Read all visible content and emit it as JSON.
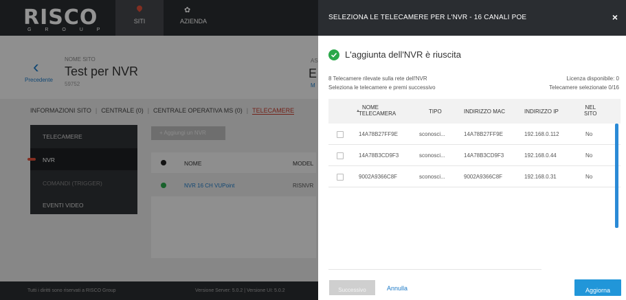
{
  "app": {
    "logo": "RISCO",
    "logo_sub": "G R O U P",
    "nav": {
      "siti": "SITI",
      "azienda": "AZIENDA"
    }
  },
  "site": {
    "back_label": "Precedente",
    "name_label": "NOME SITO",
    "name": "Test per NVR",
    "id": "59752",
    "partial_label": "AS",
    "partial_value": "E",
    "partial_link": "M"
  },
  "tabs": [
    {
      "label": "INFORMAZIONI SITO"
    },
    {
      "label": "CENTRALE (0)"
    },
    {
      "label": "CENTRALE OPERATIVA MS (0)"
    },
    {
      "label": "TELECAMERE"
    }
  ],
  "sidemenu": [
    {
      "label": "TELECAMERE"
    },
    {
      "label": "NVR"
    },
    {
      "label": "COMANDI (TRIGGER)"
    },
    {
      "label": "EVENTI VIDEO"
    }
  ],
  "nvr_list": {
    "add_button": "+ Aggiungi un NVR",
    "columns": {
      "name": "NOME",
      "model": "MODEL"
    },
    "rows": [
      {
        "name": "NVR 16 CH VUPoint",
        "model": "RISNVR"
      }
    ]
  },
  "footer": {
    "rights": "Tutti i diritti sono riservati a RISCO Group",
    "version": "Versione Server: 5.0.2  |  Versione UI: 5.0.2"
  },
  "modal": {
    "title": "SELEZIONA LE TELECAMERE PER L'NVR - 16 CANALI POE",
    "close": "×",
    "success_message": "L'aggiunta dell'NVR è riuscita",
    "info_left_1": "8 Telecamere rilevate sulla rete dell'NVR",
    "info_left_2": "Seleziona le telecamere e premi successivo",
    "info_right_1": "Licenza disponibile: 0",
    "info_right_2": "Telecamere selezionate 0/16",
    "columns": {
      "name_1": "NOME",
      "name_2": "TELECAMERA",
      "tipo": "TIPO",
      "mac": "INDIRIZZO MAC",
      "ip": "INDIRIZZO IP",
      "sito_1": "NEL",
      "sito_2": "SITO"
    },
    "cameras": [
      {
        "name": "14A78B27FF9E",
        "tipo": "sconosci...",
        "mac": "14A78B27FF9E",
        "ip": "192.168.0.112",
        "in_site": "No"
      },
      {
        "name": "14A78B3CD9F3",
        "tipo": "sconosci...",
        "mac": "14A78B3CD9F3",
        "ip": "192.168.0.44",
        "in_site": "No"
      },
      {
        "name": "9002A9366C8F",
        "tipo": "sconosci...",
        "mac": "9002A9366C8F",
        "ip": "192.168.0.31",
        "in_site": "No"
      }
    ],
    "buttons": {
      "next": "Successivo",
      "cancel": "Annulla",
      "refresh": "Aggiorna"
    }
  },
  "colors": {
    "header_bg": "#2a2d31",
    "accent_blue": "#2196d9",
    "success_green": "#2aa84a",
    "active_red": "#c53a2a"
  }
}
